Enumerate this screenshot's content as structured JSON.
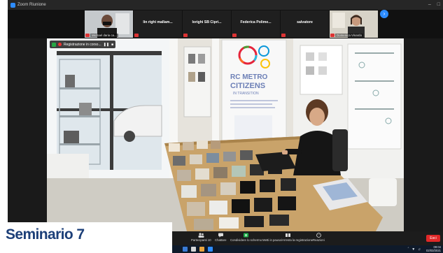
{
  "window": {
    "title": "Zoom Riunione"
  },
  "participants": [
    {
      "name": "",
      "video_label": "Michael daria ca...",
      "has_video": true
    },
    {
      "name": "lin righi mallam...",
      "has_video": false
    },
    {
      "name": "lorighi SB Cipri...",
      "has_video": false
    },
    {
      "name": "Federica Polime...",
      "has_video": false
    },
    {
      "name": "salvatore",
      "has_video": false
    },
    {
      "name": "",
      "video_label": "Domenica Vinardo",
      "has_video": true
    }
  ],
  "main_video": {
    "recording_label": "Registrazione in corso...",
    "banner": {
      "line1": "RC METRO",
      "line2": "CITIZENS",
      "line3": "IN TRANSITION"
    }
  },
  "toolbar": {
    "participants_label": "Partecipanti",
    "participants_count": "10",
    "chat_label": "Chattare",
    "share_label": "Condividere lo schermo",
    "record_label": "Metti in pausa/Arresta la registrazione",
    "reactions_label": "Reazioni",
    "end_label": "Esci"
  },
  "taskbar": {
    "time": "09:04",
    "date": "02/03/2021"
  },
  "caption": {
    "text": "Seminario 7"
  },
  "colors": {
    "accent": "#2d8cff",
    "end": "#e02828",
    "caption": "#1c3f78",
    "share": "#22b14c"
  }
}
